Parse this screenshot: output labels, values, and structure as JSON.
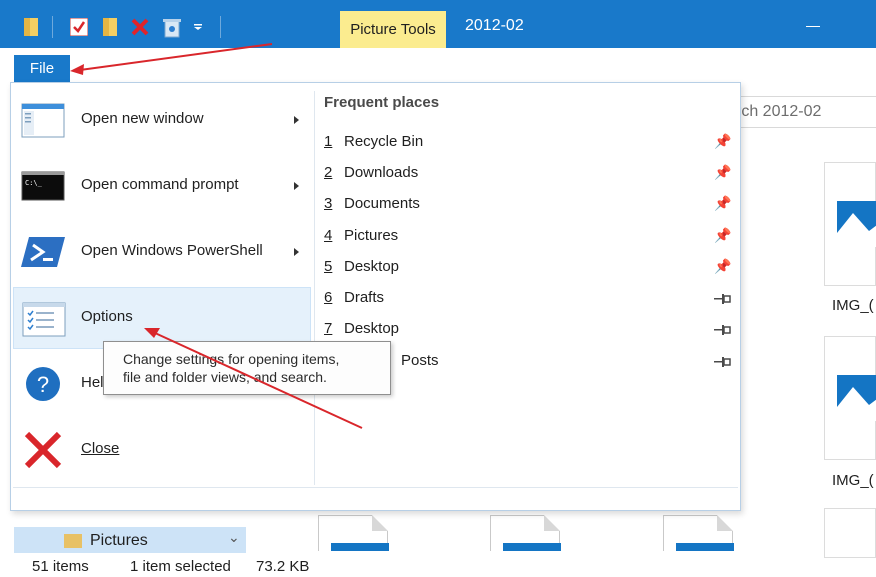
{
  "titlebar": {
    "context_tab": "Picture Tools",
    "title": "2012-02"
  },
  "ribbon": {
    "file_tab": "File"
  },
  "search": {
    "placeholder": "rch 2012-02"
  },
  "menu": {
    "items": [
      {
        "label": "Open new window",
        "has_submenu": true,
        "icon": "window-icon"
      },
      {
        "label": "Open command prompt",
        "has_submenu": true,
        "icon": "command-prompt-icon"
      },
      {
        "label": "Open Windows PowerShell",
        "has_submenu": true,
        "icon": "powershell-icon"
      },
      {
        "label": "Options",
        "has_submenu": false,
        "icon": "options-icon"
      },
      {
        "label": "Hel",
        "has_submenu": false,
        "icon": "help-icon"
      },
      {
        "label": "Close",
        "has_submenu": false,
        "icon": "close-icon"
      }
    ],
    "frequent_header": "Frequent places",
    "places": [
      {
        "num": "1",
        "name": "Recycle Bin",
        "pinned": true
      },
      {
        "num": "2",
        "name": "Downloads",
        "pinned": true
      },
      {
        "num": "3",
        "name": "Documents",
        "pinned": true
      },
      {
        "num": "4",
        "name": "Pictures",
        "pinned": true
      },
      {
        "num": "5",
        "name": "Desktop",
        "pinned": true
      },
      {
        "num": "6",
        "name": "Drafts",
        "pinned": false
      },
      {
        "num": "7",
        "name": "Desktop",
        "pinned": false
      },
      {
        "num": "",
        "name": "Posts",
        "pinned": false
      }
    ]
  },
  "tooltip": {
    "line1": "Change settings for opening items,",
    "line2": "file and folder views, and search."
  },
  "files": {
    "labels": [
      "IMG_(",
      "IMG_("
    ]
  },
  "navigation": {
    "pictures_label": "Pictures"
  },
  "status": {
    "items": "51 items",
    "selected": "1 item selected",
    "size": "73.2 KB"
  },
  "colors": {
    "titlebar": "#1979ca",
    "context_tab": "#fbec8f",
    "arrow": "#d9262b",
    "hover": "#e5f1fb"
  }
}
